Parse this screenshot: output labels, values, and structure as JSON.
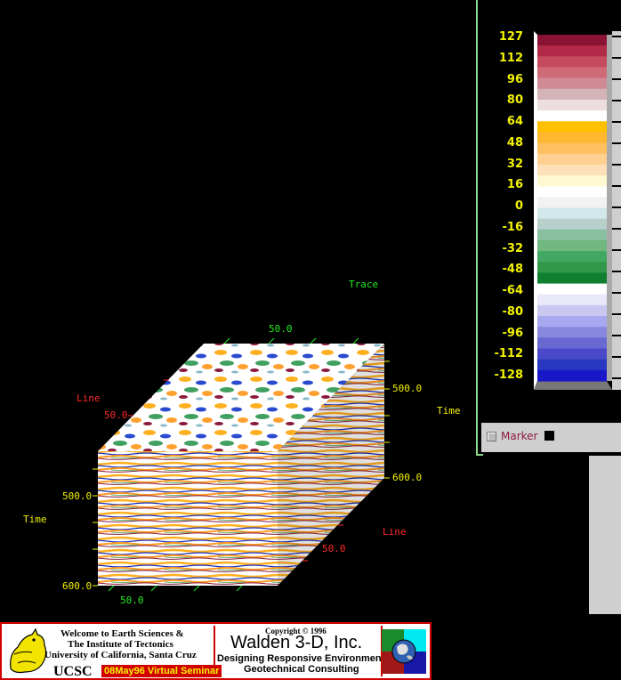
{
  "axes": {
    "trace_title": "Trace",
    "trace_tick": "50.0",
    "line_title_top": "Line",
    "line_tick_top": "50.0",
    "time_title_right": "Time",
    "time_tick_500_right": "500.0",
    "time_tick_600_right": "600.0",
    "time_title_left": "Time",
    "time_tick_500_left": "500.0",
    "time_tick_600_left": "600.0",
    "bottom_tick": "50.0",
    "line_title_bottom": "Line",
    "line_tick_bottom": "50.0"
  },
  "colorbar": {
    "ticks": [
      "127",
      "112",
      "96",
      "80",
      "64",
      "48",
      "32",
      "16",
      "0",
      "-16",
      "-32",
      "-48",
      "-64",
      "-80",
      "-96",
      "-112",
      "-128"
    ],
    "colors": [
      "#8a1232",
      "#b12a48",
      "#c64a5e",
      "#cf6a78",
      "#d08a95",
      "#d4b4b8",
      "#ecdede",
      "#ffffff",
      "#ffc000",
      "#ffb830",
      "#ffc060",
      "#ffd090",
      "#fee0b8",
      "#fff8d0",
      "#ffffff",
      "#f2f2f2",
      "#d0e8ea",
      "#b8d0cc",
      "#88c0a0",
      "#70b880",
      "#40a860",
      "#309848",
      "#108030",
      "#ffffff",
      "#e8e8f8",
      "#c8c8f0",
      "#a8a8f0",
      "#8888e0",
      "#6868d0",
      "#4848c8",
      "#2838c0",
      "#1818c8"
    ]
  },
  "marker": {
    "label": "Marker"
  },
  "banner": {
    "welcome_line1": "Welcome to Earth Sciences &",
    "welcome_line2": "The Institute of Tectonics",
    "welcome_line3": "University of California, Santa Cruz",
    "ucsc": "UCSC",
    "seminar": "08May96 Virtual Seminar",
    "copyright": "Copyright © 1996",
    "company": "Walden 3-D, Inc.",
    "tagline1": "Designing Responsive Environments",
    "tagline2": "Geotechnical Consulting"
  }
}
